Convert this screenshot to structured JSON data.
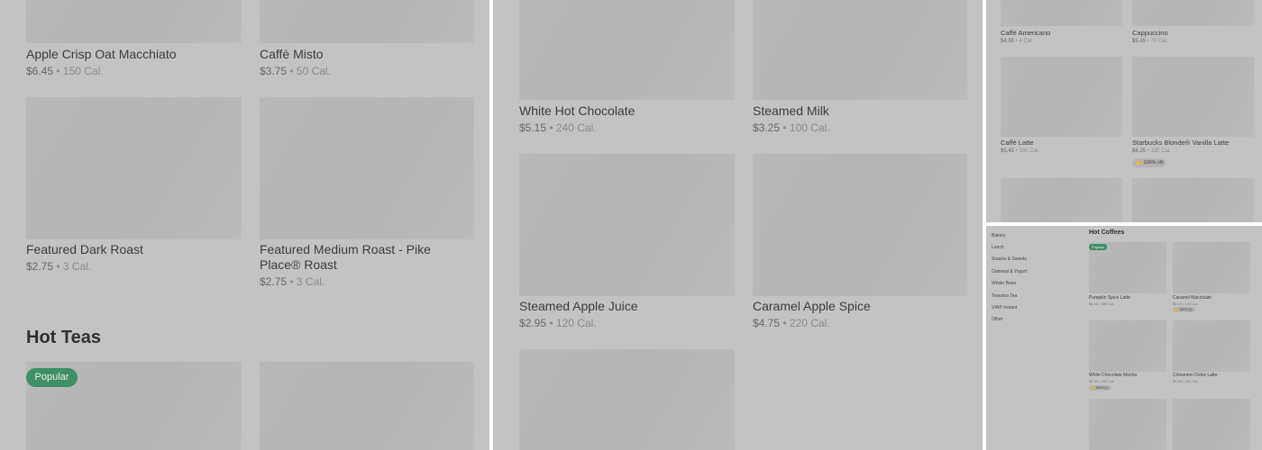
{
  "panel1": {
    "row1": [
      {
        "name": "Apple Crisp Oat Macchiato",
        "price": "$6.45",
        "cal": "150 Cal."
      },
      {
        "name": "Caffè Misto",
        "price": "$3.75",
        "cal": "50 Cal."
      }
    ],
    "row2": [
      {
        "name": "Featured Dark Roast",
        "price": "$2.75",
        "cal": "3 Cal."
      },
      {
        "name_line1": "Featured Medium Roast - Pike",
        "name_line2": "Place® Roast",
        "price": "$2.75",
        "cal": "3 Cal."
      }
    ],
    "section_title": "Hot Teas",
    "badge": "Popular"
  },
  "panel2": {
    "row1": [
      {
        "name": "White Hot Chocolate",
        "price": "$5.15",
        "cal": "240 Cal."
      },
      {
        "name": "Steamed Milk",
        "price": "$3.25",
        "cal": "100 Cal."
      }
    ],
    "row2": [
      {
        "name": "Steamed Apple Juice",
        "price": "$2.95",
        "cal": "120 Cal."
      },
      {
        "name": "Caramel Apple Spice",
        "price": "$4.75",
        "cal": "220 Cal."
      }
    ]
  },
  "panel3": {
    "row1": [
      {
        "name": "Caffè Americano",
        "price": "$4.55",
        "cal": "4 Cal."
      },
      {
        "name": "Cappuccino",
        "price": "$5.45",
        "cal": "70 Cal."
      }
    ],
    "row2": [
      {
        "name": "Caffè Latte",
        "price": "$5.45",
        "cal": "100 Cal."
      },
      {
        "name": "Starbucks Blonde® Vanilla Latte",
        "price": "$6.25",
        "cal": "130 Cal.",
        "rating": "100% (4)"
      }
    ]
  },
  "panel4": {
    "nav": [
      "Bakery",
      "Lunch",
      "Snacks & Sweets",
      "Oatmeal & Yogurt",
      "Whole Bean",
      "Teavana Tea",
      "VIA® Instant",
      "Other"
    ],
    "section_title": "Hot Coffees",
    "badge": "Popular",
    "row1": [
      {
        "name": "Pumpkin Spice Latte",
        "price": "$6.45",
        "cal": "380 Cal."
      },
      {
        "name": "Caramel Macchiato",
        "price": "$6.15",
        "cal": "120 Cal.",
        "rating": "100% (9)"
      }
    ],
    "row2": [
      {
        "name": "White Chocolate Mocha",
        "price": "$6.45",
        "cal": "230 Cal.",
        "rating": "100% (3)"
      },
      {
        "name": "Cinnamon Dolce Latte",
        "price": "$6.45",
        "cal": "180 Cal."
      }
    ]
  },
  "icons": {
    "rating": "thumbs-up-icon"
  }
}
